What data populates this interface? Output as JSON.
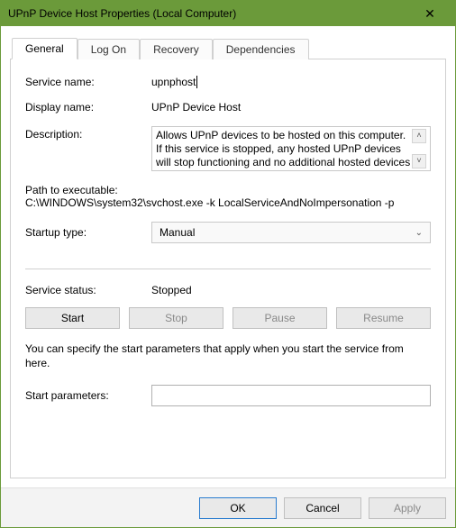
{
  "window": {
    "title": "UPnP Device Host Properties (Local Computer)"
  },
  "tabs": [
    "General",
    "Log On",
    "Recovery",
    "Dependencies"
  ],
  "activeTab": 0,
  "general": {
    "labels": {
      "serviceName": "Service name:",
      "displayName": "Display name:",
      "description": "Description:",
      "pathHeading": "Path to executable:",
      "startupType": "Startup type:",
      "serviceStatus": "Service status:",
      "startParameters": "Start parameters:"
    },
    "serviceName": "upnphost",
    "displayName": "UPnP Device Host",
    "description": "Allows UPnP devices to be hosted on this computer. If this service is stopped, any hosted UPnP devices will stop functioning and no additional hosted devices",
    "path": "C:\\WINDOWS\\system32\\svchost.exe -k LocalServiceAndNoImpersonation -p",
    "startupType": "Manual",
    "serviceStatus": "Stopped",
    "buttons": {
      "start": "Start",
      "stop": "Stop",
      "pause": "Pause",
      "resume": "Resume"
    },
    "note": "You can specify the start parameters that apply when you start the service from here.",
    "startParameters": ""
  },
  "footer": {
    "ok": "OK",
    "cancel": "Cancel",
    "apply": "Apply"
  }
}
